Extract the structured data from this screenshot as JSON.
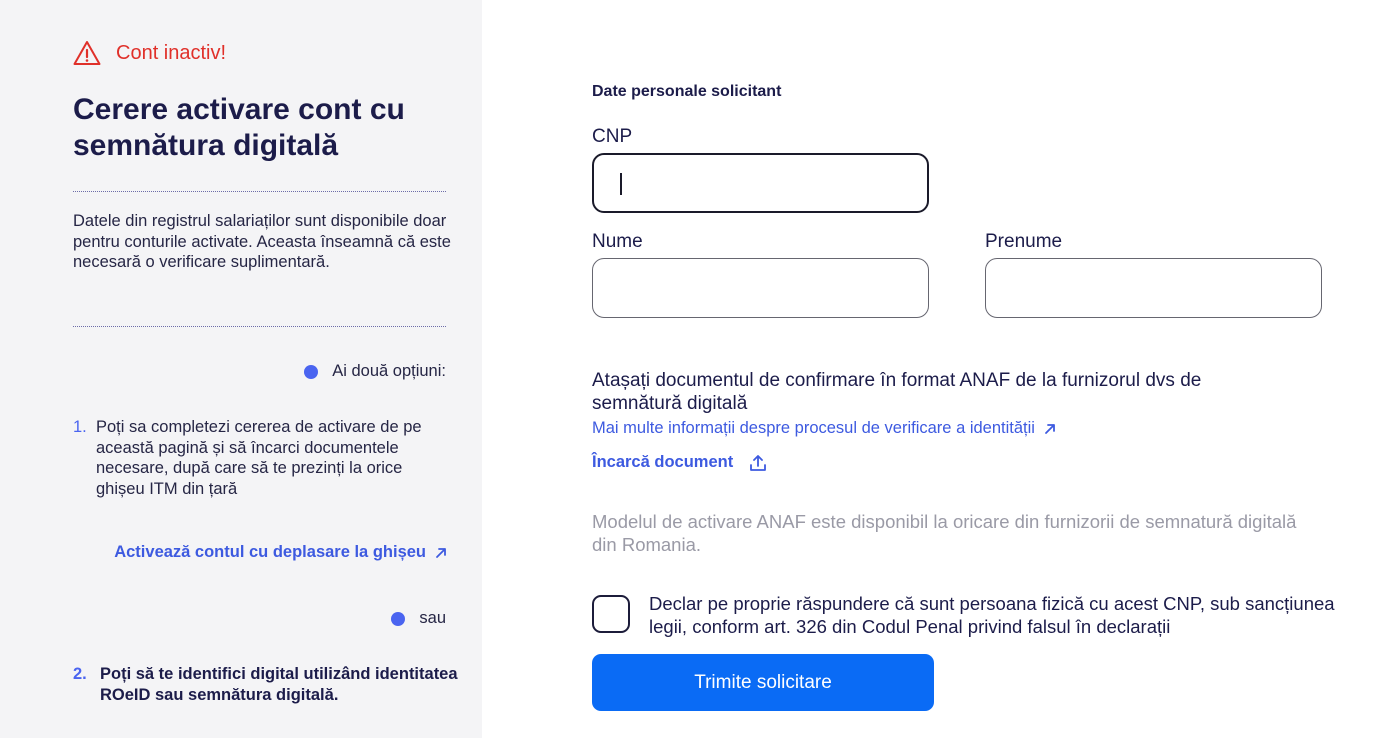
{
  "left": {
    "warning": "Cont inactiv!",
    "title": "Cerere activare cont cu semnătura digitală",
    "description": "Datele din registrul salariaților sunt disponibile doar pentru conturile activate. Aceasta înseamnă că este necesară o verificare suplimentară.",
    "options_label": "Ai două opțiuni:",
    "step1_num": "1.",
    "step1_text": "Poți sa completezi cererea de activare de pe această pagină și să încarci documentele necesare, după care să te prezinți la orice ghișeu ITM din țară",
    "link_ghiseu": "Activează contul cu deplasare la ghișeu",
    "or_label": "sau",
    "step2_num": "2.",
    "step2_text": "Poți să te identifici digital utilizând identitatea ROeID sau semnătura digitală."
  },
  "form": {
    "section_title": "Date personale solicitant",
    "cnp_label": "CNP",
    "cnp_value": "",
    "nume_label": "Nume",
    "nume_value": "",
    "prenume_label": "Prenume",
    "prenume_value": "",
    "attach_title": "Atașați documentul de confirmare în format ANAF de la furnizorul dvs de semnătură digitală",
    "info_link": "Mai multe informații despre procesul de verificare a identității",
    "upload_label": "Încarcă document",
    "note": "Modelul de activare ANAF este disponibil la oricare din furnizorii de semnatură digitală din Romania.",
    "declaration": "Declar pe proprie răspundere că sunt persoana fizică cu acest CNP, sub sancțiunea legii, conform art. 326 din Codul Penal privind falsul în declarații",
    "submit_label": "Trimite solicitare"
  },
  "colors": {
    "accent": "#3d5ae0",
    "button": "#0a6bf5",
    "warning": "#e0302a",
    "panel_bg": "#f4f4f6"
  }
}
